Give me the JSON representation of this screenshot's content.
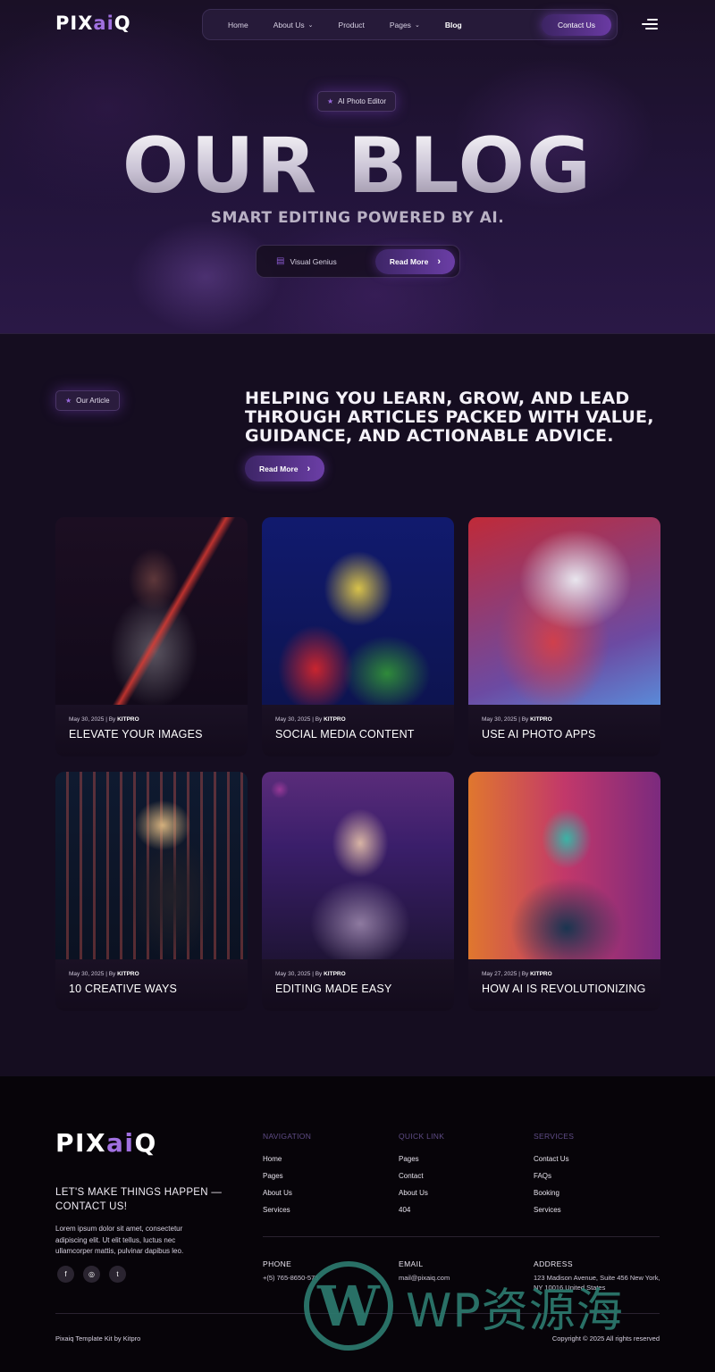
{
  "brand": {
    "logo_text_a": "PIX",
    "logo_text_ai": "ai",
    "logo_text_b": "Q"
  },
  "nav": {
    "items": [
      {
        "label": "Home",
        "dropdown": false
      },
      {
        "label": "About Us",
        "dropdown": true
      },
      {
        "label": "Product",
        "dropdown": false
      },
      {
        "label": "Pages",
        "dropdown": true
      },
      {
        "label": "Blog",
        "dropdown": false,
        "active": true
      }
    ],
    "contact_label": "Contact Us"
  },
  "hero": {
    "tag": "AI Photo Editor",
    "title": "OUR BLOG",
    "subtitle": "SMART EDITING POWERED BY AI.",
    "cta_left": "Visual Genius",
    "cta_button": "Read More"
  },
  "articles": {
    "tag": "Our Article",
    "headline": "HELPING YOU LEARN, GROW, AND LEAD THROUGH ARTICLES PACKED WITH VALUE, GUIDANCE, AND ACTIONABLE ADVICE.",
    "button": "Read More",
    "cards": [
      {
        "date": "May 30, 2025 | By ",
        "author": "KITPRO",
        "title": "ELEVATE YOUR IMAGES"
      },
      {
        "date": "May 30, 2025 | By ",
        "author": "KITPRO",
        "title": "SOCIAL MEDIA CONTENT"
      },
      {
        "date": "May 30, 2025 | By ",
        "author": "KITPRO",
        "title": "USE AI PHOTO APPS"
      },
      {
        "date": "May 30, 2025 | By ",
        "author": "KITPRO",
        "title": "10 CREATIVE WAYS"
      },
      {
        "date": "May 30, 2025 | By ",
        "author": "KITPRO",
        "title": "EDITING MADE EASY"
      },
      {
        "date": "May 27, 2025 | By ",
        "author": "KITPRO",
        "title": "HOW AI IS REVOLUTIONIZING"
      }
    ]
  },
  "footer": {
    "tagline": "LET'S MAKE THINGS HAPPEN — CONTACT US!",
    "description": "Lorem ipsum dolor sit amet, consectetur adipiscing elit. Ut elit tellus, luctus nec ullamcorper mattis, pulvinar dapibus leo.",
    "socials": [
      "f",
      "◎",
      "t"
    ],
    "columns": [
      {
        "heading": "NAVIGATION",
        "links": [
          "Home",
          "Pages",
          "About Us",
          "Services"
        ]
      },
      {
        "heading": "QUICK LINK",
        "links": [
          "Pages",
          "Contact",
          "About Us",
          "404"
        ]
      },
      {
        "heading": "SERVICES",
        "links": [
          "Contact Us",
          "FAQs",
          "Booking",
          "Services"
        ]
      }
    ],
    "contact": [
      {
        "label": "PHONE",
        "value": "+(5) 765-8650-575"
      },
      {
        "label": "EMAIL",
        "value": "mail@pixaiq.com"
      },
      {
        "label": "ADDRESS",
        "value": "123 Madison Avenue, Suite 456 New York, NY 10016 United States"
      }
    ],
    "copyright_left": "Pixaiq Template Kit by Kitpro",
    "copyright_right": "Copyright © 2025 All rights reserved"
  },
  "watermark": {
    "letter": "W",
    "text": "WP资源海"
  }
}
